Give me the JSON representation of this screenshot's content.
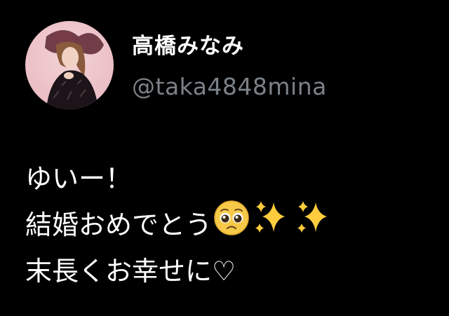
{
  "tweet": {
    "author": {
      "display_name": "高橋みなみ",
      "handle": "@taka4848mina",
      "avatar_icon": "profile-photo"
    },
    "lines": [
      {
        "text": "ゆいー！",
        "emoji": []
      },
      {
        "text": "結婚おめでとう",
        "emoji": [
          "pleading-face-icon",
          "sparkles-icon",
          "sparkles-icon"
        ]
      },
      {
        "text": "末長くお幸せに♡",
        "emoji": []
      }
    ]
  },
  "colors": {
    "background": "#000000",
    "text": "#ffffff",
    "handle": "#7b8187",
    "emoji_yellow": "#f7c948",
    "sparkle_yellow": "#ffcc3d"
  }
}
